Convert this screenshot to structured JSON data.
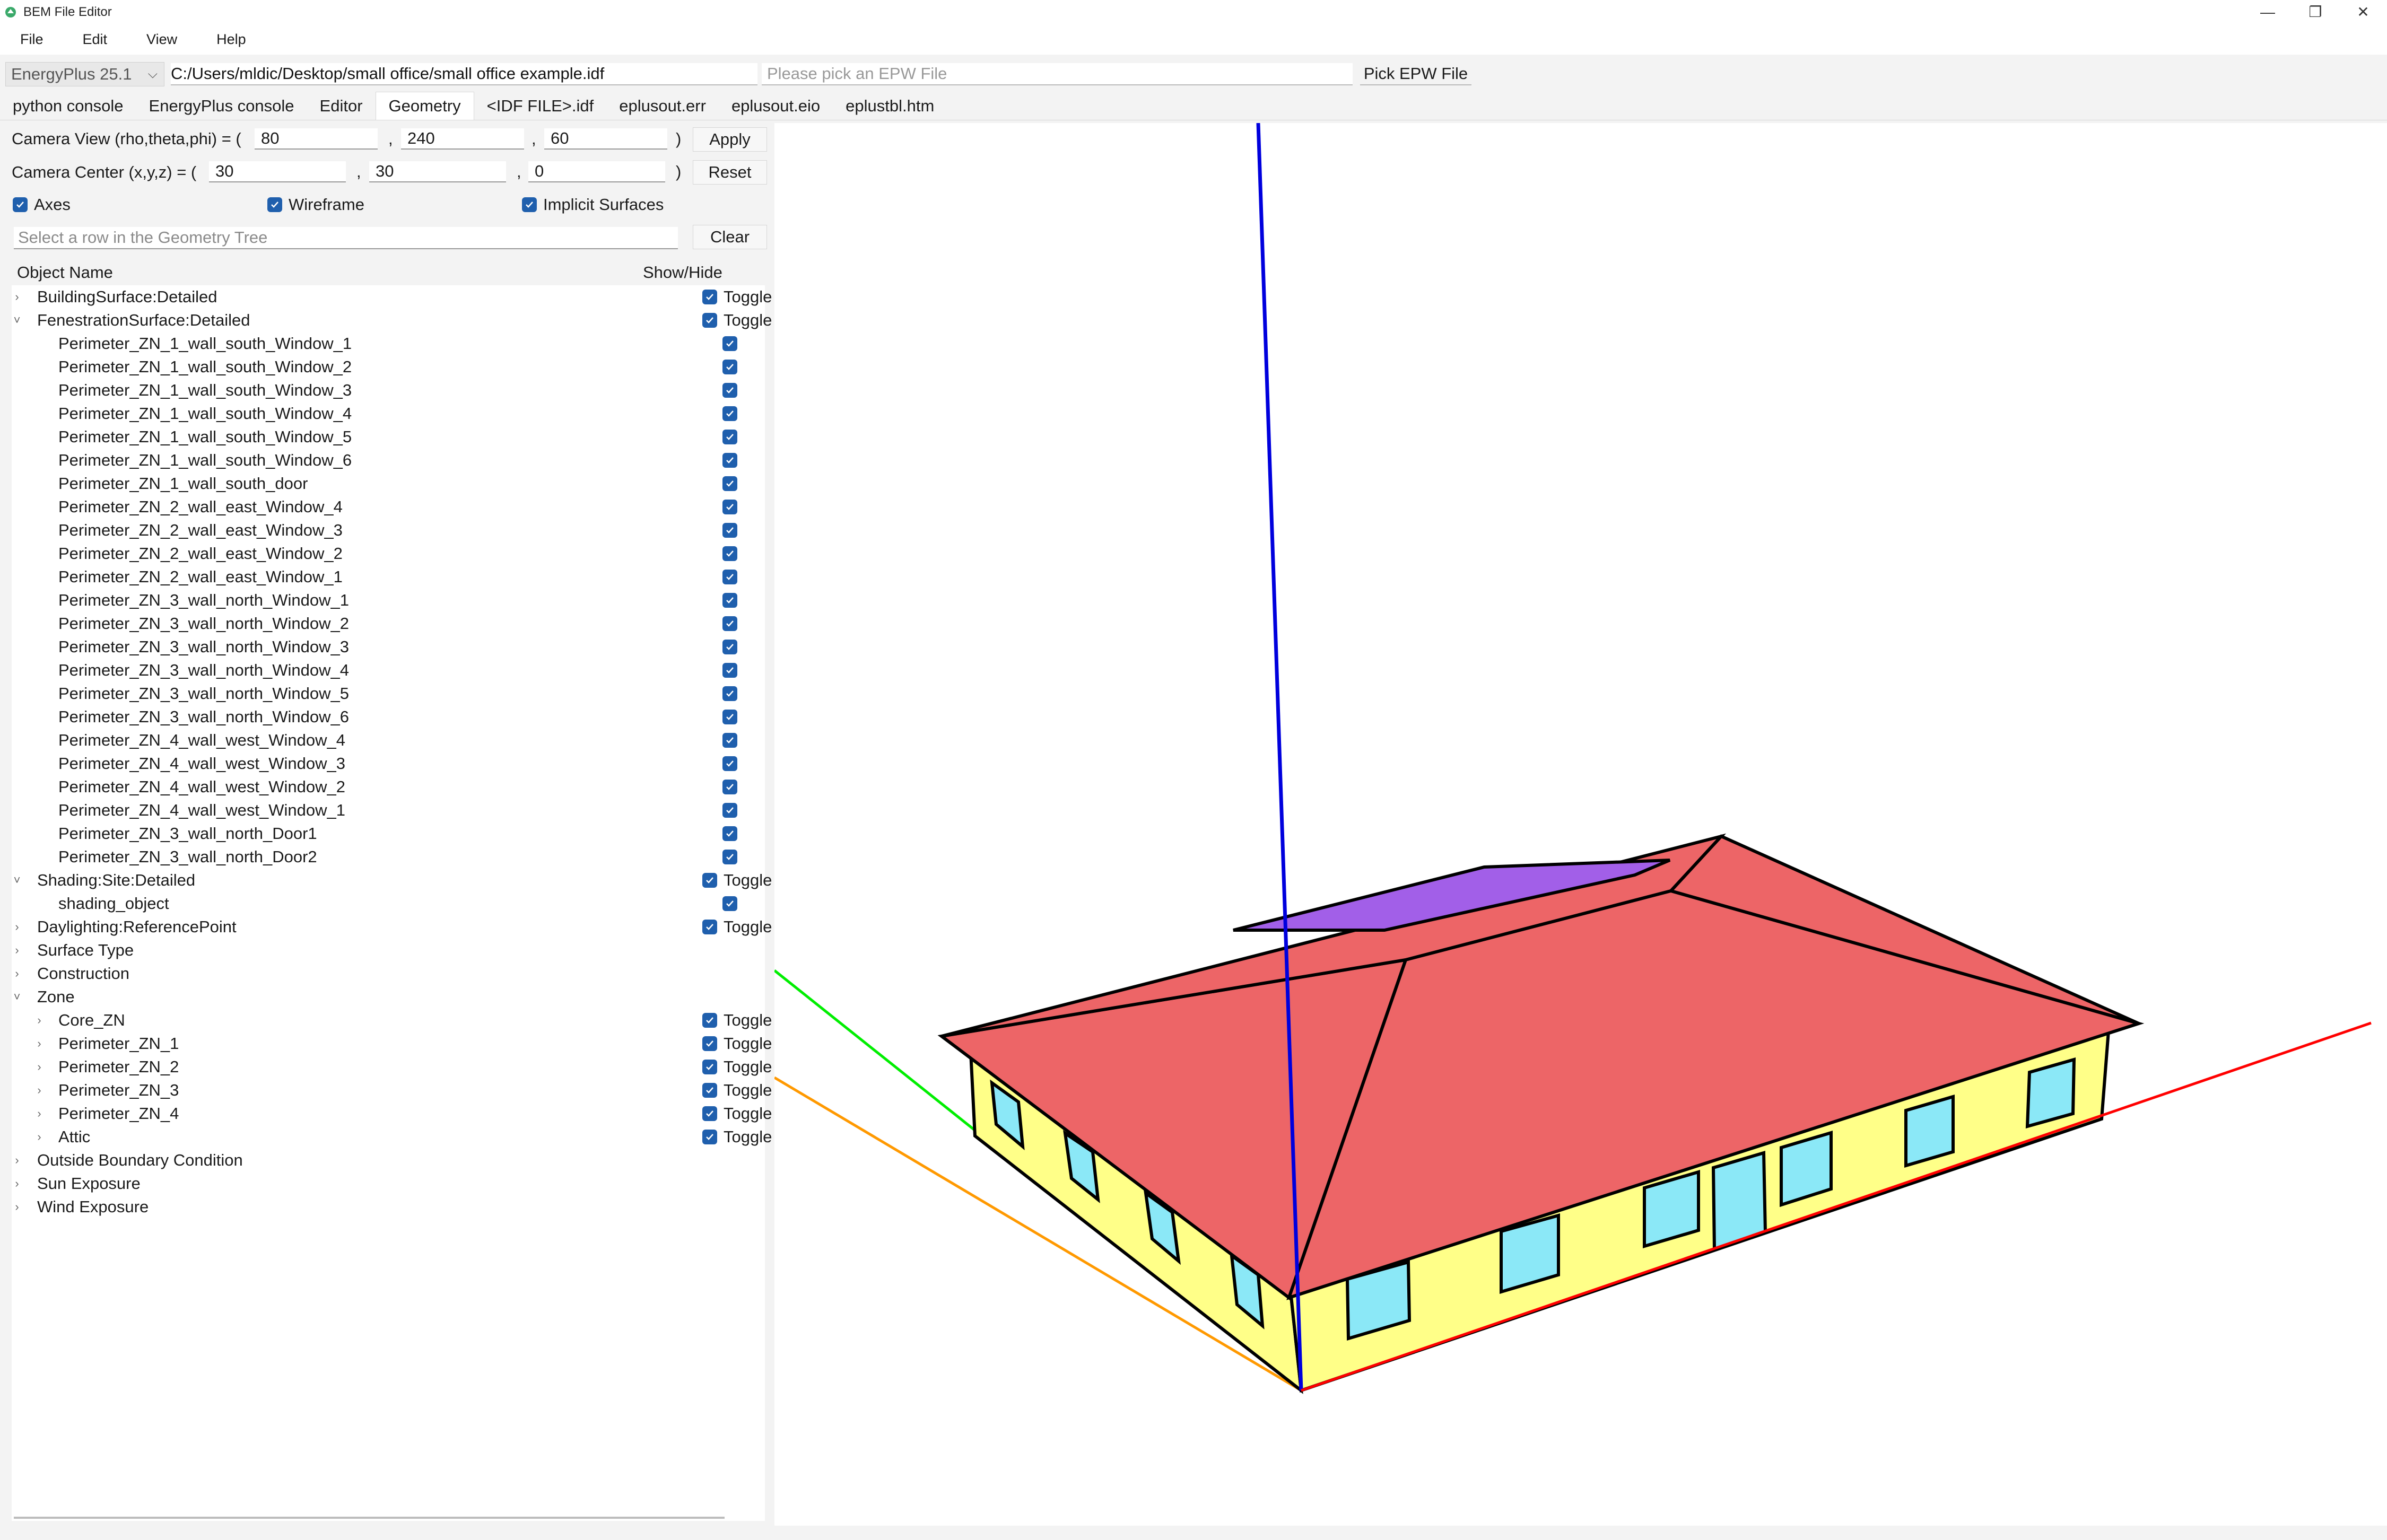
{
  "window": {
    "title": "BEM File Editor",
    "controls": [
      "—",
      "❐",
      "✕"
    ]
  },
  "menu": [
    "File",
    "Edit",
    "View",
    "Help"
  ],
  "pathbar": {
    "version": "EnergyPlus 25.1",
    "idf_path": "C:/Users/mldic/Desktop/small office/small office example.idf",
    "epw_placeholder": "Please pick an EPW File",
    "pick_epw_label": "Pick EPW File"
  },
  "tabs": [
    "python console",
    "EnergyPlus console",
    "Editor",
    "Geometry",
    "<IDF FILE>.idf",
    "eplusout.err",
    "eplusout.eio",
    "eplustbl.htm"
  ],
  "active_tab": "Geometry",
  "camera": {
    "view_label": "Camera View (rho,theta,phi) = (",
    "view_values": [
      "80",
      "240",
      "60"
    ],
    "center_label": "Camera Center (x,y,z) = (",
    "center_values": [
      "30",
      "30",
      "0"
    ],
    "comma": ",",
    "close_paren": ")",
    "apply_label": "Apply",
    "reset_label": "Reset"
  },
  "options": {
    "axes": "Axes",
    "wireframe": "Wireframe",
    "implicit_surfaces": "Implicit Surfaces"
  },
  "geo_search": {
    "placeholder": "Select a row in the Geometry Tree",
    "clear_label": "Clear"
  },
  "tree": {
    "col_object": "Object Name",
    "col_showhide": "Show/Hide",
    "toggle_label": "Toggle",
    "rows": [
      {
        "label": "BuildingSurface:Detailed",
        "level": 0,
        "arrow": "›",
        "check": "toggle"
      },
      {
        "label": "FenestrationSurface:Detailed",
        "level": 0,
        "arrow": "˅",
        "check": "toggle"
      },
      {
        "label": "Perimeter_ZN_1_wall_south_Window_1",
        "level": 1,
        "arrow": "",
        "check": "box"
      },
      {
        "label": "Perimeter_ZN_1_wall_south_Window_2",
        "level": 1,
        "arrow": "",
        "check": "box"
      },
      {
        "label": "Perimeter_ZN_1_wall_south_Window_3",
        "level": 1,
        "arrow": "",
        "check": "box"
      },
      {
        "label": "Perimeter_ZN_1_wall_south_Window_4",
        "level": 1,
        "arrow": "",
        "check": "box"
      },
      {
        "label": "Perimeter_ZN_1_wall_south_Window_5",
        "level": 1,
        "arrow": "",
        "check": "box"
      },
      {
        "label": "Perimeter_ZN_1_wall_south_Window_6",
        "level": 1,
        "arrow": "",
        "check": "box"
      },
      {
        "label": "Perimeter_ZN_1_wall_south_door",
        "level": 1,
        "arrow": "",
        "check": "box"
      },
      {
        "label": "Perimeter_ZN_2_wall_east_Window_4",
        "level": 1,
        "arrow": "",
        "check": "box"
      },
      {
        "label": "Perimeter_ZN_2_wall_east_Window_3",
        "level": 1,
        "arrow": "",
        "check": "box"
      },
      {
        "label": "Perimeter_ZN_2_wall_east_Window_2",
        "level": 1,
        "arrow": "",
        "check": "box"
      },
      {
        "label": "Perimeter_ZN_2_wall_east_Window_1",
        "level": 1,
        "arrow": "",
        "check": "box"
      },
      {
        "label": "Perimeter_ZN_3_wall_north_Window_1",
        "level": 1,
        "arrow": "",
        "check": "box"
      },
      {
        "label": "Perimeter_ZN_3_wall_north_Window_2",
        "level": 1,
        "arrow": "",
        "check": "box"
      },
      {
        "label": "Perimeter_ZN_3_wall_north_Window_3",
        "level": 1,
        "arrow": "",
        "check": "box"
      },
      {
        "label": "Perimeter_ZN_3_wall_north_Window_4",
        "level": 1,
        "arrow": "",
        "check": "box"
      },
      {
        "label": "Perimeter_ZN_3_wall_north_Window_5",
        "level": 1,
        "arrow": "",
        "check": "box"
      },
      {
        "label": "Perimeter_ZN_3_wall_north_Window_6",
        "level": 1,
        "arrow": "",
        "check": "box"
      },
      {
        "label": "Perimeter_ZN_4_wall_west_Window_4",
        "level": 1,
        "arrow": "",
        "check": "box"
      },
      {
        "label": "Perimeter_ZN_4_wall_west_Window_3",
        "level": 1,
        "arrow": "",
        "check": "box"
      },
      {
        "label": "Perimeter_ZN_4_wall_west_Window_2",
        "level": 1,
        "arrow": "",
        "check": "box"
      },
      {
        "label": "Perimeter_ZN_4_wall_west_Window_1",
        "level": 1,
        "arrow": "",
        "check": "box"
      },
      {
        "label": "Perimeter_ZN_3_wall_north_Door1",
        "level": 1,
        "arrow": "",
        "check": "box"
      },
      {
        "label": "Perimeter_ZN_3_wall_north_Door2",
        "level": 1,
        "arrow": "",
        "check": "box"
      },
      {
        "label": "Shading:Site:Detailed",
        "level": 0,
        "arrow": "˅",
        "check": "toggle"
      },
      {
        "label": "shading_object",
        "level": 1,
        "arrow": "",
        "check": "box"
      },
      {
        "label": "Daylighting:ReferencePoint",
        "level": 0,
        "arrow": "›",
        "check": "toggle"
      },
      {
        "label": "Surface Type",
        "level": 0,
        "arrow": "›",
        "check": "none"
      },
      {
        "label": "Construction",
        "level": 0,
        "arrow": "›",
        "check": "none"
      },
      {
        "label": "Zone",
        "level": 0,
        "arrow": "˅",
        "check": "none"
      },
      {
        "label": "Core_ZN",
        "level": 1,
        "arrow": "›",
        "check": "toggle"
      },
      {
        "label": "Perimeter_ZN_1",
        "level": 1,
        "arrow": "›",
        "check": "toggle"
      },
      {
        "label": "Perimeter_ZN_2",
        "level": 1,
        "arrow": "›",
        "check": "toggle"
      },
      {
        "label": "Perimeter_ZN_3",
        "level": 1,
        "arrow": "›",
        "check": "toggle"
      },
      {
        "label": "Perimeter_ZN_4",
        "level": 1,
        "arrow": "›",
        "check": "toggle"
      },
      {
        "label": "Attic",
        "level": 1,
        "arrow": "›",
        "check": "toggle"
      },
      {
        "label": "Outside Boundary Condition",
        "level": 0,
        "arrow": "›",
        "check": "none"
      },
      {
        "label": "Sun Exposure",
        "level": 0,
        "arrow": "›",
        "check": "none"
      },
      {
        "label": "Wind Exposure",
        "level": 0,
        "arrow": "›",
        "check": "none"
      }
    ]
  },
  "colors": {
    "accent": "#1f5fad",
    "roof": "#ed6567",
    "wall": "#ffff88",
    "window": "#8be8f7",
    "shading": "#a25fe8",
    "axis_x": "#ff0000",
    "axis_y": "#00ee00",
    "axis_z": "#0000dd",
    "axis_extra": "#ff9900"
  }
}
